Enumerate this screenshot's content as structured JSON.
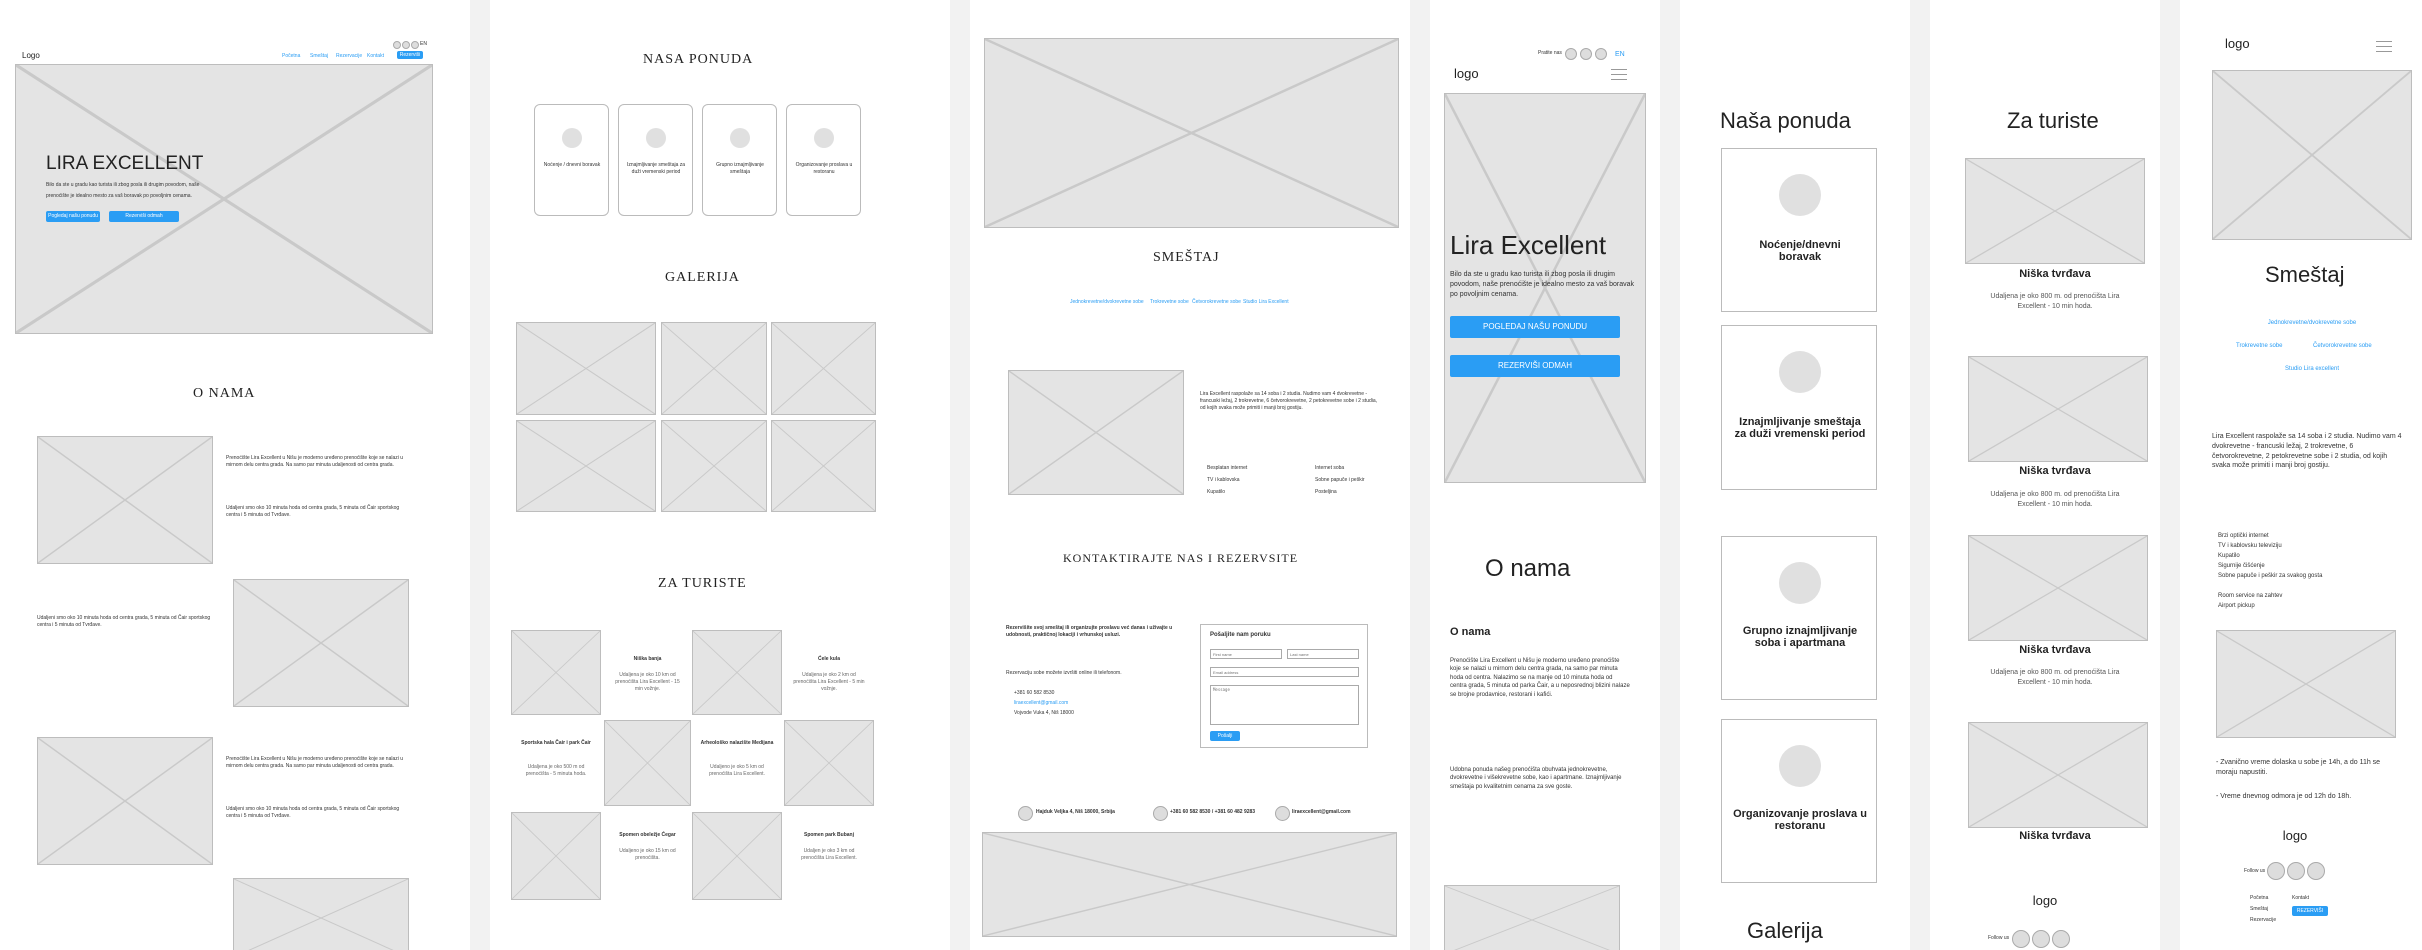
{
  "d1": {
    "logo": "Logo",
    "nav": [
      "Početna",
      "Smeštaj",
      "Rezervacije",
      "Kontakt"
    ],
    "cta": "Rezerviši",
    "lang": "EN",
    "hero_title": "LIRA EXCELLENT",
    "hero_text_1": "Bilo da ste u gradu kao turista ili zbog posla ili drugim povodom, naše",
    "hero_text_2": "prenoćište je idealno mesto za vaš boravak po povoljnim cenama.",
    "hero_btn1": "Pogledaj našu ponudu",
    "hero_btn2": "Rezerviši odmah",
    "about_title": "O NAMA",
    "about_p": "Prenoćište Lira Excellent u Nišu je moderno uređeno prenoćište koje se nalazi u mirnom delu centra grada. Na samo par minuta udaljenosti od centra grada.",
    "about_p2": "Udaljeni smo oko 10 minuta hoda od centra grada, 5 minuta od Čair sportskog centra i 5 minuta od Tvrđave."
  },
  "d2": {
    "offer_title": "NASA PONUDA",
    "offers": [
      "Noćenje / dnevni boravak",
      "Iznajmljivanje smeštaja za duži vremenski period",
      "Grupno iznajmljivanje smeštaja",
      "Organizovanje proslava u restoranu"
    ],
    "gallery_title": "GALERIJA",
    "tourist_title": "ZA TURISTE",
    "places": [
      {
        "name": "Niška banja",
        "desc": "Udaljena je oko 10 km od prenoćišta Lira Excellent - 15 min vožnje."
      },
      {
        "name": "Ćele kula",
        "desc": "Udaljena je oko 2 km od prenoćišta Lira Excellent - 5 min vožnje."
      },
      {
        "name": "Sportska hala Čair i park Čair",
        "desc": "Udaljena je oko 500 m od prenoćišta - 5 minuta hoda."
      },
      {
        "name": "Arheološko nalazište Medijana",
        "desc": "Udaljeno je oko 5 km od prenoćišta Lira Excellent."
      },
      {
        "name": "Spomen obeležje Ćegar",
        "desc": "Udaljeno je oko 15 km od prenoćišta."
      },
      {
        "name": "Spomen park Bubanj",
        "desc": "Udaljen je oko 3 km od prenoćišta Lira Excellent."
      }
    ]
  },
  "d3": {
    "accom_title": "SMEŠTAJ",
    "tabs": [
      "Jednokrevetne/dvokrevetne sobe",
      "Trokrevetne sobe",
      "Četvorokrevetne sobe",
      "Studio Lira Excellent"
    ],
    "accom_text": "Lira Excellent raspolaže sa 14 soba i 2 studia. Nudimo vam 4 dvokrevetne - francuski ležaj, 2 trokrevetne, 6 četvorokrevetne, 2 petokrevetne sobe i 2 studia, od kojih svaka može primiti i manji broj gostiju.",
    "amenities": [
      "Besplatan internet",
      "Internet soba",
      "TV i kablovska",
      "Sobne papuče i peškir",
      "Kupatilo",
      "Posteljina"
    ],
    "contact_title": "KONTAKTIRAJTE NAS I REZERVSITE",
    "contact_lead": "Rezervišite svoj smeštaj ili organizujte proslavu već danas i uživajte u udobnosti, praktičnoj lokaciji i vrhunskoj usluzi.",
    "contact_small": "Rezervaciju sobe možete izvršiti online ili telefonom.",
    "phone": "+381 60 582 8530",
    "email": "liraexcellent@gmail.com",
    "address": "Vojvode Vuka 4, Niš 18000",
    "form_title": "Pošaljite nam poruku",
    "first_name": "First name",
    "last_name": "Last name",
    "email_ph": "Email address",
    "message_ph": "Message",
    "send": "Pošalji",
    "footer_addr": "Hajduk Veljka 4, Niš 18000, Srbija",
    "footer_phone": "+381 60 582 8530 / +381 60 482 9283",
    "footer_mail": "liraexcellent@gmail.com"
  },
  "d4": {
    "follow": "Pratite nas",
    "lang": "EN",
    "logo": "logo",
    "hero_title": "Lira Excellent",
    "hero_text": "Bilo da ste u gradu kao turista ili zbog posla ili drugim povodom, naše prenoćište je idealno mesto za vaš boravak po povoljnim cenama.",
    "btn1": "POGLEDAJ NAŠU PONUDU",
    "btn2": "REZERVIŠI ODMAH",
    "about_title": "O nama",
    "about_sub": "O nama",
    "about_p1": "Prenoćište Lira Excellent u Nišu je moderno uređeno prenoćište koje se nalazi u mirnom delu centra grada, na samo par minuta hoda od centra. Nalazimo se na manje od 10 minuta hoda od centra grada, 5 minuta od parka Čair, a u neposrednoj blizini nalaze se brojne prodavnice, restorani i kafići.",
    "about_p2": "Udobna ponuda našeg prenoćišta obuhvata jednokrevetne, dvokrevetne i višekrevetne sobe, kao i apartmane. Iznajmljivanje smeštaja po kvalitetnim cenama za sve goste."
  },
  "d5": {
    "title": "Naša ponuda",
    "cards": [
      "Noćenje/dnevni boravak",
      "Iznajmljivanje smeštaja za duži vremenski period",
      "Grupno iznajmljivanje soba i apartmana",
      "Organizovanje proslava u restoranu"
    ],
    "gallery": "Galerija"
  },
  "d6": {
    "title": "Za turiste",
    "places": [
      "Niška tvrđava",
      "Niška tvrđava",
      "Niška tvrđava",
      "Niška tvrđava"
    ],
    "desc": "Udaljena je oko 800 m. od prenoćišta Lira Excellent - 10 min hoda.",
    "logo": "logo",
    "follow": "Follow us"
  },
  "d7": {
    "logo": "logo",
    "accom_title": "Smeštaj",
    "tabs": [
      "Jednokrevetne/dvokrevetne sobe",
      "Trokrevetne sobe",
      "Četvorokrevetne sobe",
      "Studio Lira excellent"
    ],
    "text": "Lira Excellent raspolaže sa 14 soba i 2 studia. Nudimo vam 4 dvokrevetne - francuski ležaj, 2 trokrevetne, 6 četvorokrevetne, 2 petokrevetne sobe i 2 studia, od kojih svaka može primiti i manji broj gostiju.",
    "amenities": [
      "Brzi optički internet",
      "TV i kablovsku televiziju",
      "Kupatilo",
      "Sigurnije čišćenje",
      "Sobne papuče i peškir za svakog gosta",
      "Room service na zahtev",
      "Airport pickup"
    ],
    "note1": "- Zvanično vreme dolaska u sobe je 14h, a do 11h se moraju napustiti.",
    "note2": "- Vreme dnevnog odmora je od 12h do 18h.",
    "footer_logo": "logo",
    "follow": "Follow us",
    "links": [
      "Početna",
      "Kontakt",
      "Smeštaj",
      "Rezervacije"
    ],
    "cta": "REZERVIŠI"
  }
}
